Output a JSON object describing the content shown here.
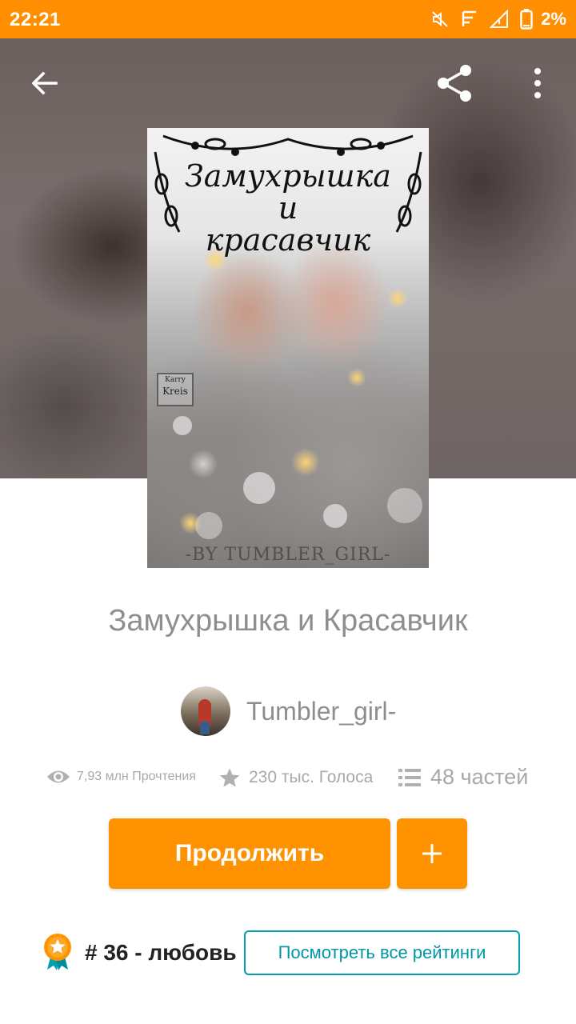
{
  "status_bar": {
    "time": "22:21",
    "battery_percent": "2%",
    "background_color": "#ff8f00",
    "icons": [
      "mute-icon",
      "notification-icon",
      "signal-icon",
      "battery-icon"
    ]
  },
  "toolbar": {
    "back_icon": "arrow-left-icon",
    "share_icon": "share-icon",
    "more_icon": "more-vertical-icon"
  },
  "cover": {
    "title_line1": "Замухрышка",
    "title_line2": "и",
    "title_line3": "красавчик",
    "stamp_line1": "Karry",
    "stamp_line2": "Kreis",
    "bottom_text": "-BY TUMBLER_GIRL-"
  },
  "story": {
    "title": "Замухрышка и Красавчик",
    "author": "Tumbler_girl-"
  },
  "stats": {
    "reads": "7,93 млн Прочтения",
    "votes": "230 тыс. Голоса",
    "parts": "48 частей"
  },
  "actions": {
    "continue_label": "Продолжить",
    "add_icon": "plus-icon",
    "accent_color": "#ff9200"
  },
  "ranking": {
    "rank": "# 36",
    "separator": " - ",
    "category": "любовь",
    "view_all_label": "Посмотреть все рейтинги",
    "link_color": "#0096a8"
  }
}
